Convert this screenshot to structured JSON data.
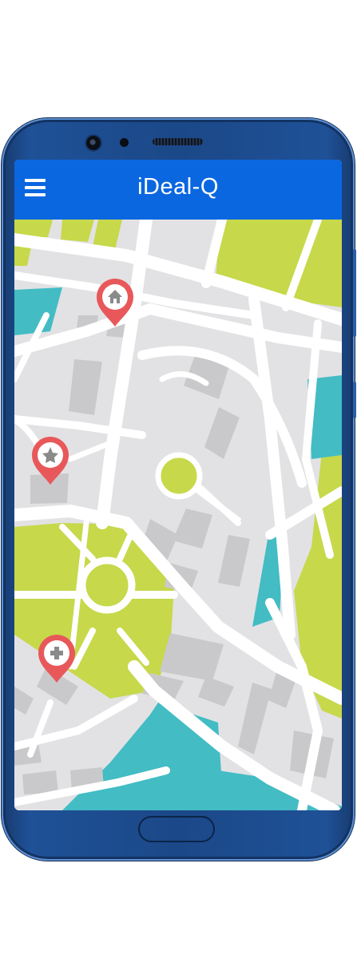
{
  "app_bar": {
    "title": "iDeal-Q",
    "menu_icon": "hamburger-menu-icon",
    "background_color": "#0a67e0"
  },
  "map": {
    "markers": [
      {
        "icon": "home-icon",
        "color": "#e8585a"
      },
      {
        "icon": "star-icon",
        "color": "#e8585a"
      },
      {
        "icon": "plus-icon",
        "color": "#e8585a"
      }
    ],
    "colors": {
      "land": "#e2e2e4",
      "road": "#ffffff",
      "park": "#c7d84a",
      "water": "#43bcc4",
      "building": "#c9c9cb"
    }
  },
  "device": {
    "frame_color": "#1b4888"
  }
}
